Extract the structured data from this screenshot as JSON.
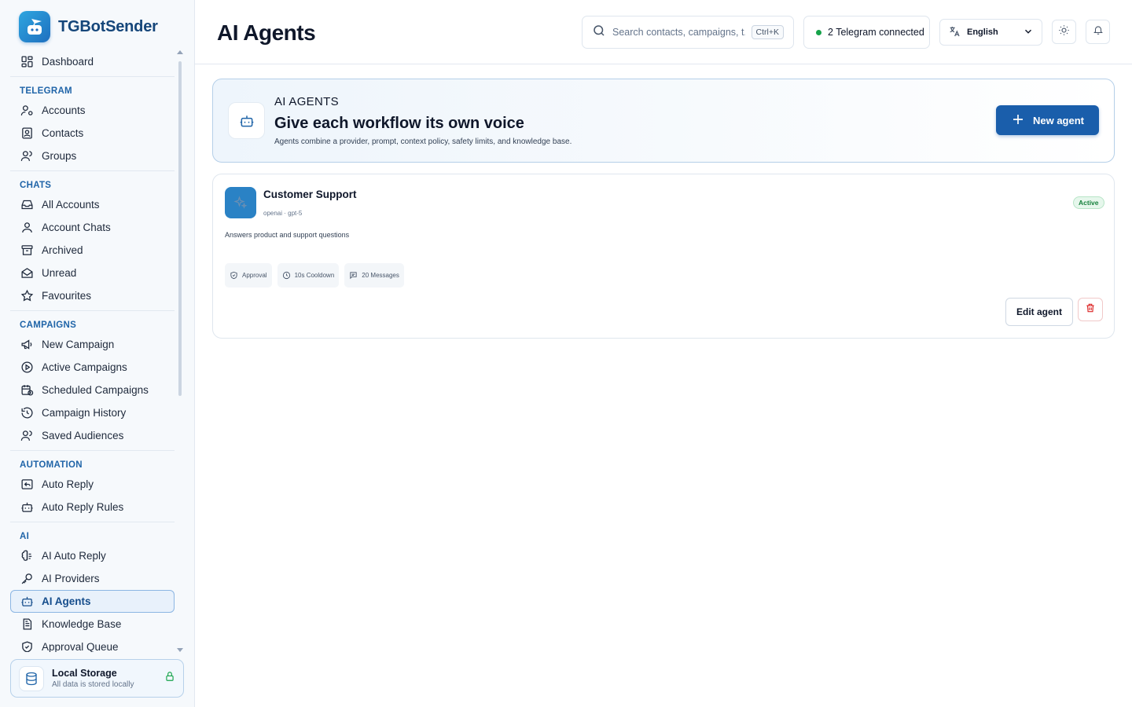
{
  "brand": {
    "name": "TGBotSender"
  },
  "sidebar": {
    "dashboard": "Dashboard",
    "sections": {
      "telegram": "TELEGRAM",
      "chats": "CHATS",
      "campaigns": "CAMPAIGNS",
      "automation": "AUTOMATION",
      "ai": "AI"
    },
    "items": {
      "accounts": "Accounts",
      "contacts": "Contacts",
      "groups": "Groups",
      "all_accounts": "All Accounts",
      "account_chats": "Account Chats",
      "archived": "Archived",
      "unread": "Unread",
      "favourites": "Favourites",
      "new_campaign": "New Campaign",
      "active_campaigns": "Active Campaigns",
      "scheduled_campaigns": "Scheduled Campaigns",
      "campaign_history": "Campaign History",
      "saved_audiences": "Saved Audiences",
      "auto_reply": "Auto Reply",
      "auto_reply_rules": "Auto Reply Rules",
      "ai_auto_reply": "AI Auto Reply",
      "ai_providers": "AI Providers",
      "ai_agents": "AI Agents",
      "knowledge_base": "Knowledge Base",
      "approval_queue": "Approval Queue"
    },
    "active_item": "ai_agents",
    "storage": {
      "title": "Local Storage",
      "subtitle": "All data is stored locally"
    }
  },
  "header": {
    "title": "AI Agents",
    "search_placeholder": "Search contacts, campaigns, t...",
    "search_shortcut": "Ctrl+K",
    "telegram_status": "2 Telegram connected",
    "language": "English"
  },
  "hero": {
    "eyebrow": "AI AGENTS",
    "title": "Give each workflow its own voice",
    "subtitle": "Agents combine a provider, prompt, context policy, safety limits, and knowledge base.",
    "new_agent_label": "New agent"
  },
  "agents": [
    {
      "name": "Customer Support",
      "model": "openai · gpt-5",
      "status": "Active",
      "description": "Answers product and support questions",
      "chips": {
        "approval": "Approval",
        "cooldown": "10s Cooldown",
        "messages": "20 Messages"
      },
      "edit_label": "Edit agent"
    }
  ],
  "colors": {
    "accent": "#1a5eab",
    "brand": "#15467a",
    "section": "#1f64a8",
    "status_active": "#16803c",
    "online": "#16a34a",
    "danger": "#dc2626"
  }
}
